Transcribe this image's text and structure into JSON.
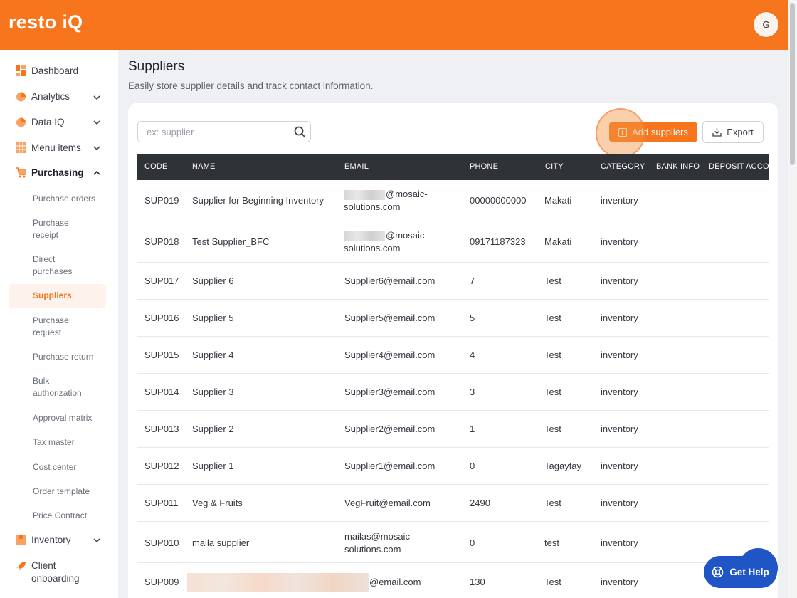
{
  "app": {
    "logo": "resto iQ",
    "avatar_initial": "G"
  },
  "sidebar": {
    "dashboard": "Dashboard",
    "analytics": "Analytics",
    "data_iq": "Data IQ",
    "menu_items": "Menu items",
    "purchasing": "Purchasing",
    "purchasing_sub": [
      "Purchase orders",
      "Purchase receipt",
      "Direct purchases",
      "Suppliers",
      "Purchase request",
      "Purchase return",
      "Bulk authorization",
      "Approval matrix",
      "Tax master",
      "Cost center",
      "Order template",
      "Price Contract"
    ],
    "inventory": "Inventory",
    "client_onboarding": "Client onboarding"
  },
  "page": {
    "title": "Suppliers",
    "subtitle": "Easily store supplier details and track contact information."
  },
  "toolbar": {
    "search_placeholder": "ex: supplier",
    "add_label": "Add suppliers",
    "export_label": "Export"
  },
  "table": {
    "headers": [
      "CODE",
      "NAME",
      "EMAIL",
      "PHONE",
      "CITY",
      "CATEGORY",
      "BANK INFO",
      "DEPOSIT ACCOUNT"
    ],
    "rows": [
      {
        "code": "SUP019",
        "name": "Supplier for Beginning Inventory",
        "email_a": "@mosaic-",
        "email_b": "solutions.com",
        "phone": "00000000000",
        "city": "Makati",
        "category": "inventory"
      },
      {
        "code": "SUP018",
        "name": "Test Supplier_BFC",
        "email_a": "@mosaic-",
        "email_b": "solutions.com",
        "phone": "09171187323",
        "city": "Makati",
        "category": "inventory"
      },
      {
        "code": "SUP017",
        "name": "Supplier 6",
        "email": "Supplier6@email.com",
        "phone": "7",
        "city": "Test",
        "category": "inventory"
      },
      {
        "code": "SUP016",
        "name": "Supplier 5",
        "email": "Supplier5@email.com",
        "phone": "5",
        "city": "Test",
        "category": "inventory"
      },
      {
        "code": "SUP015",
        "name": "Supplier 4",
        "email": "Supplier4@email.com",
        "phone": "4",
        "city": "Test",
        "category": "inventory"
      },
      {
        "code": "SUP014",
        "name": "Supplier 3",
        "email": "Supplier3@email.com",
        "phone": "3",
        "city": "Test",
        "category": "inventory"
      },
      {
        "code": "SUP013",
        "name": "Supplier 2",
        "email": "Supplier2@email.com",
        "phone": "1",
        "city": "Test",
        "category": "inventory"
      },
      {
        "code": "SUP012",
        "name": "Supplier 1",
        "email": "Supplier1@email.com",
        "phone": "0",
        "city": "Tagaytay",
        "category": "inventory"
      },
      {
        "code": "SUP011",
        "name": "Veg & Fruits",
        "email": "VegFruit@email.com",
        "phone": "2490",
        "city": "Test",
        "category": "inventory"
      },
      {
        "code": "SUP010",
        "name": "maila supplier",
        "email_a": "mailas@mosaic-",
        "email_b": "solutions.com",
        "phone": "0",
        "city": "test",
        "category": "inventory"
      },
      {
        "code": "SUP009",
        "name": "",
        "email": "@email.com",
        "phone": "130",
        "city": "Test",
        "category": "inventory"
      }
    ]
  },
  "help": {
    "label": "Get Help"
  },
  "colors": {
    "brand": "#f7761d",
    "header_dark": "#2f3338",
    "help_blue": "#1f55c4"
  }
}
